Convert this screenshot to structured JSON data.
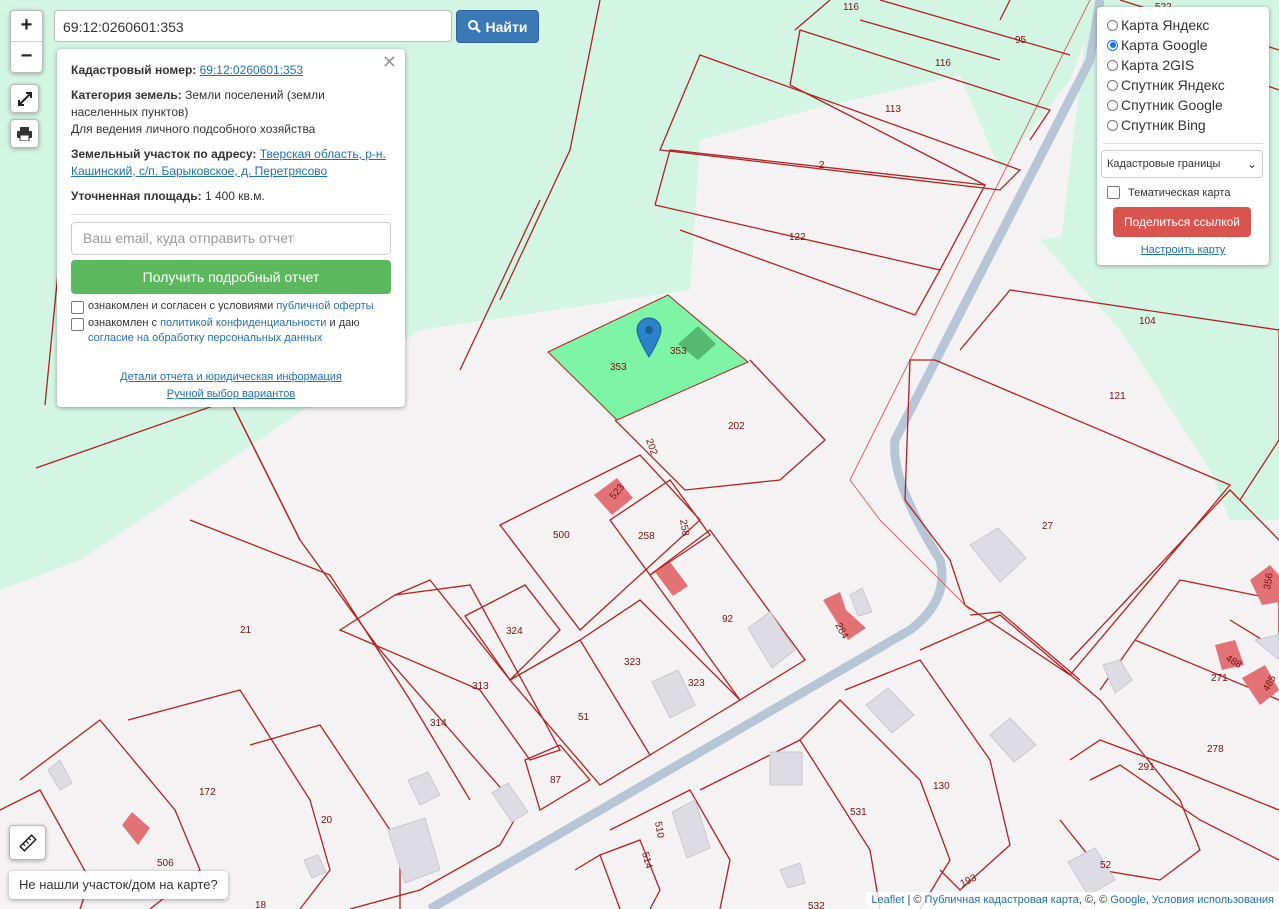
{
  "search": {
    "value": "69:12:0260601:353",
    "button_label": "Найти"
  },
  "zoom": {
    "in": "+",
    "out": "−"
  },
  "info_panel": {
    "cad_label": "Кадастровый номер:",
    "cad_value": "69:12:0260601:353",
    "cat_label": "Категория земель:",
    "cat_value": "Земли поселений (земли",
    "cat_value_2": "населенных пунктов)",
    "usage": "Для ведения личного подсобного хозяйства",
    "addr_label": "Земельный участок по адресу:",
    "addr_value": "Тверская область, р-н.",
    "addr_value_2": "Кашинский, с/п. Барыковское, д. Перетрясово",
    "area_label": "Уточненная площадь:",
    "area_value": "1 400 кв.м.",
    "email_placeholder": "Ваш email, куда отправить отчет",
    "report_button": "Получить подробный отчет",
    "agree1_a": "ознакомлен и согласен с условиями",
    "agree1_link": "публичной оферты",
    "agree2_a": "ознакомлен с",
    "agree2_link": "политикой конфиденциальности",
    "agree2_b": "и даю",
    "agree2_link2": "согласие на обработку персональных данных",
    "details_link": "Детали отчета и юридическая информация",
    "manual_link": "Ручной выбор вариантов"
  },
  "layers": {
    "options": [
      "Карта Яндекс",
      "Карта Google",
      "Карта 2GIS",
      "Спутник Яндекс",
      "Спутник Google",
      "Спутник Bing"
    ],
    "selected_index": 1,
    "boundaries_select": "Кадастровые границы",
    "thematic_label": "Тематическая карта",
    "share_button": "Поделиться ссылкой",
    "configure_link": "Настроить карту"
  },
  "not_found": "Не нашли участок/дом на карте?",
  "attribution": {
    "leaflet": "Leaflet",
    "sep1": " | © ",
    "pkk": "Публичная кадастровая карта",
    "mid": ", ©, © ",
    "google": "Google",
    "comma": ", ",
    "terms": "Условия использования"
  },
  "map_labels": {
    "l116a": "116",
    "l95": "95",
    "l116b": "116",
    "l113": "113",
    "l2": "2",
    "l122": "122",
    "l104": "104",
    "l522": "522",
    "l353a": "353",
    "l353b": "353",
    "l202a": "202",
    "l202b": "202",
    "l121": "121",
    "l27": "27",
    "l523": "523",
    "l500": "500",
    "l258a": "258",
    "l258b": "258",
    "l92": "92",
    "l284": "284",
    "l324": "324",
    "l323a": "323",
    "l323b": "323",
    "l313": "313",
    "l314": "314",
    "l21": "21",
    "l51": "51",
    "l87": "87",
    "l172": "172",
    "l20": "20",
    "l506": "506",
    "l18": "18",
    "l510": "510",
    "l514": "514",
    "l531": "531",
    "l130": "130",
    "l193": "193",
    "l52": "52",
    "l291": "291",
    "l278": "278",
    "l271": "271",
    "l488": "488",
    "l485": "485",
    "l356": "356",
    "l532": "532"
  },
  "colors": {
    "green_zone": "#d3f5e3",
    "selected_parcel": "#7ef5a6",
    "boundary": "#b22222",
    "building": "#e27276",
    "road": "#b7c6d6"
  }
}
